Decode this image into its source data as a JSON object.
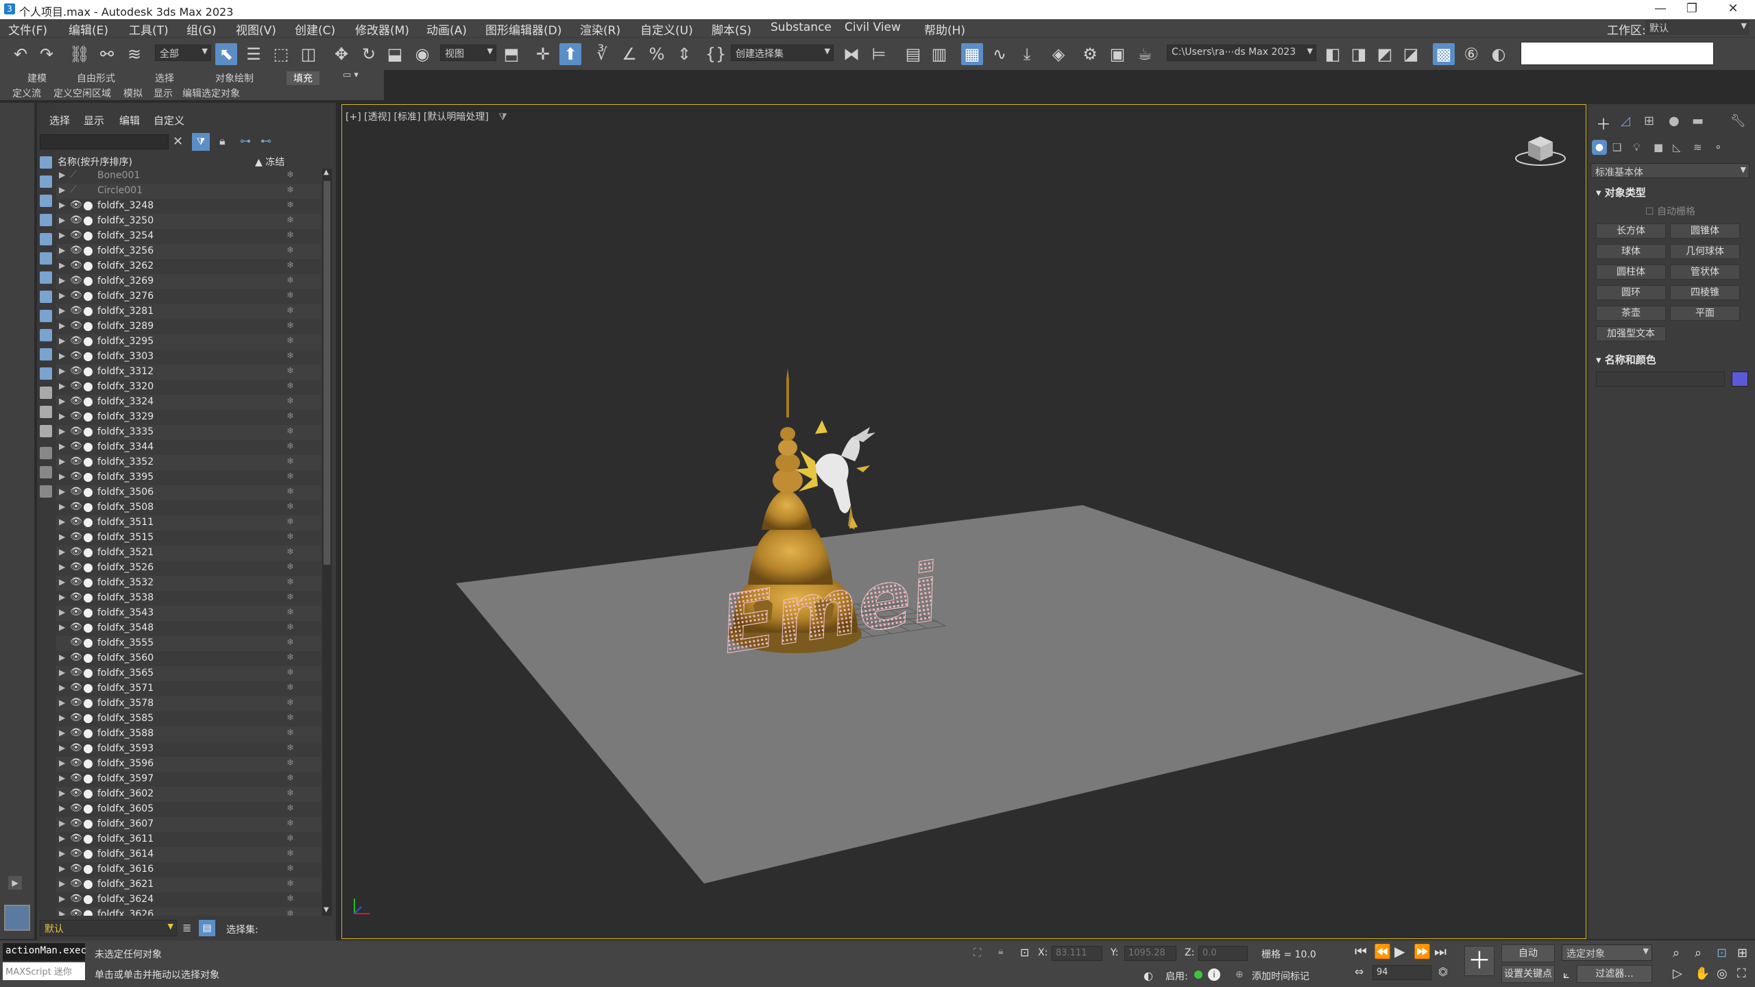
{
  "window": {
    "title": "个人项目.max - Autodesk 3ds Max 2023",
    "min": "—",
    "restore": "❐",
    "close": "✕"
  },
  "menubar": {
    "items": [
      "文件(F)",
      "编辑(E)",
      "工具(T)",
      "组(G)",
      "视图(V)",
      "创建(C)",
      "修改器(M)",
      "动画(A)",
      "图形编辑器(D)",
      "渲染(R)",
      "自定义(U)",
      "脚本(S)",
      "Substance",
      "Civil View",
      "帮助(H)"
    ],
    "workspace_label": "工作区:",
    "workspace_value": "默认"
  },
  "toolbar": {
    "filter_value": "全部",
    "ref_coord_value": "视图",
    "selection_set_placeholder": "创建选择集",
    "path_value": "C:\\Users\\ra⋯ds Max 2023",
    "search_value": ""
  },
  "ribbon": {
    "tabs_row1": [
      "建模",
      "自由形式",
      "选择",
      "对象绘制",
      "填充"
    ],
    "selected_tab": "填充",
    "tabs_row2": [
      "定义流",
      "定义空闲区域",
      "模拟",
      "显示",
      "编辑选定对象"
    ]
  },
  "explorer": {
    "tabs": [
      "选择",
      "显示",
      "编辑",
      "自定义"
    ],
    "column_name": "名称(按升序排序)",
    "column_frozen": "▲ 冻结",
    "layer_value": "默认",
    "selection_set_label": "选择集:",
    "rows": [
      {
        "name": "Bone001",
        "dim": true
      },
      {
        "name": "Circle001",
        "dim": true
      },
      {
        "name": "foldfx_3248"
      },
      {
        "name": "foldfx_3250"
      },
      {
        "name": "foldfx_3254"
      },
      {
        "name": "foldfx_3256"
      },
      {
        "name": "foldfx_3262"
      },
      {
        "name": "foldfx_3269"
      },
      {
        "name": "foldfx_3276"
      },
      {
        "name": "foldfx_3281"
      },
      {
        "name": "foldfx_3289"
      },
      {
        "name": "foldfx_3295"
      },
      {
        "name": "foldfx_3303"
      },
      {
        "name": "foldfx_3312"
      },
      {
        "name": "foldfx_3320"
      },
      {
        "name": "foldfx_3324"
      },
      {
        "name": "foldfx_3329"
      },
      {
        "name": "foldfx_3335"
      },
      {
        "name": "foldfx_3344"
      },
      {
        "name": "foldfx_3352"
      },
      {
        "name": "foldfx_3395"
      },
      {
        "name": "foldfx_3506"
      },
      {
        "name": "foldfx_3508"
      },
      {
        "name": "foldfx_3511"
      },
      {
        "name": "foldfx_3515"
      },
      {
        "name": "foldfx_3521"
      },
      {
        "name": "foldfx_3526"
      },
      {
        "name": "foldfx_3532"
      },
      {
        "name": "foldfx_3538"
      },
      {
        "name": "foldfx_3543"
      },
      {
        "name": "foldfx_3548"
      },
      {
        "name": "foldfx_3555"
      },
      {
        "name": "foldfx_3560"
      },
      {
        "name": "foldfx_3565"
      },
      {
        "name": "foldfx_3571"
      },
      {
        "name": "foldfx_3578"
      },
      {
        "name": "foldfx_3585"
      },
      {
        "name": "foldfx_3588"
      },
      {
        "name": "foldfx_3593"
      },
      {
        "name": "foldfx_3596"
      },
      {
        "name": "foldfx_3597"
      },
      {
        "name": "foldfx_3602"
      },
      {
        "name": "foldfx_3605"
      },
      {
        "name": "foldfx_3607"
      },
      {
        "name": "foldfx_3611"
      },
      {
        "name": "foldfx_3614"
      },
      {
        "name": "foldfx_3616"
      },
      {
        "name": "foldfx_3621"
      },
      {
        "name": "foldfx_3624"
      },
      {
        "name": "foldfx_3626"
      }
    ]
  },
  "viewport": {
    "label": "[+] [透视] [标准] [默认明暗处理]",
    "scene_text": "Emei"
  },
  "command_panel": {
    "dropdown_value": "标准基本体",
    "section_object_type": "对象类型",
    "auto_grid": "自动栅格",
    "buttons": [
      "长方体",
      "圆锥体",
      "球体",
      "几何球体",
      "圆柱体",
      "管状体",
      "圆环",
      "四棱锥",
      "茶壶",
      "平面",
      "加强型文本"
    ],
    "section_name_color": "名称和颜色",
    "name_value": "",
    "object_color": "#5a5ad6"
  },
  "statusbar": {
    "script_line1": "actionMan.exec",
    "script_line2": "MAXScript 迷你",
    "status_line1": "未选定任何对象",
    "status_line2": "单击或单击并拖动以选择对象",
    "x_label": "X:",
    "x_value": "83.111",
    "y_label": "Y:",
    "y_value": "1095.28",
    "z_label": "Z:",
    "z_value": "0.0",
    "grid_text": "栅格 = 10.0",
    "enable_label": "启用:",
    "add_time_tag": "添加时间标记",
    "auto_key": "自动",
    "set_key": "设置关键点",
    "selected_object": "选定对象",
    "filters": "过滤器...",
    "frame_value": "94"
  }
}
